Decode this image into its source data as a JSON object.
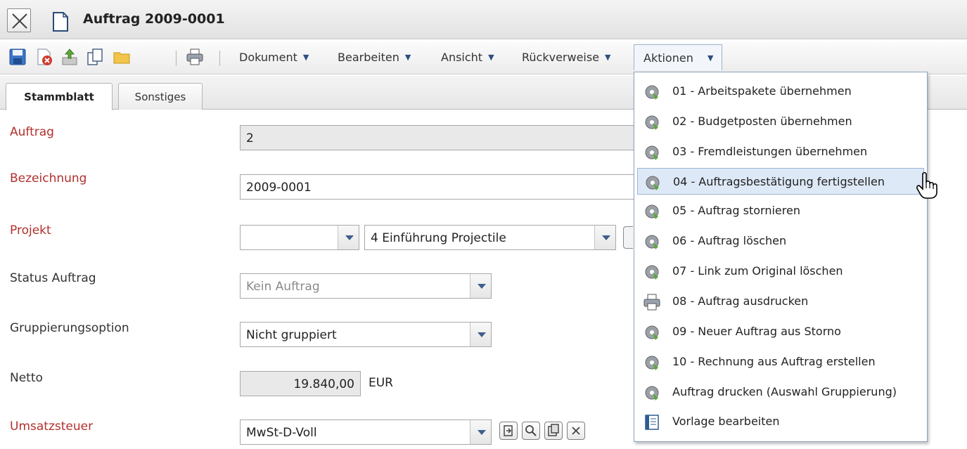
{
  "window": {
    "title": "Auftrag 2009-0001"
  },
  "toolbar": {
    "icons": [
      "save-icon",
      "delete-icon",
      "upload-icon",
      "copy-icon",
      "folder-icon",
      "print-icon"
    ],
    "menus": [
      {
        "label": "Dokument"
      },
      {
        "label": "Bearbeiten"
      },
      {
        "label": "Ansicht"
      },
      {
        "label": "Rückverweise"
      },
      {
        "label": "Aktionen"
      }
    ]
  },
  "tabs": [
    {
      "label": "Stammblatt",
      "active": true
    },
    {
      "label": "Sonstiges",
      "active": false
    }
  ],
  "form": {
    "auftrag": {
      "label": "Auftrag",
      "value": "2"
    },
    "bezeichnung": {
      "label": "Bezeichnung",
      "value": "2009-0001"
    },
    "projekt": {
      "label": "Projekt",
      "value1": "",
      "value2": "4 Einführung Projectile"
    },
    "status": {
      "label": "Status Auftrag",
      "value": "Kein Auftrag"
    },
    "gruppierung": {
      "label": "Gruppierungsoption",
      "value": "Nicht gruppiert"
    },
    "netto": {
      "label": "Netto",
      "value": "19.840,00",
      "unit": "EUR"
    },
    "umsatzsteuer": {
      "label": "Umsatzsteuer",
      "value": "MwSt-D-Voll"
    }
  },
  "actions_menu": {
    "items": [
      {
        "label": "01 - Arbeitspakete übernehmen",
        "icon": "gear-icon"
      },
      {
        "label": "02 - Budgetposten übernehmen",
        "icon": "gear-icon"
      },
      {
        "label": "03 - Fremdleistungen übernehmen",
        "icon": "gear-icon"
      },
      {
        "label": "04 - Auftragsbestätigung fertigstellen",
        "icon": "gear-icon",
        "hover": true
      },
      {
        "label": "05 - Auftrag stornieren",
        "icon": "gear-icon"
      },
      {
        "label": "06 - Auftrag löschen",
        "icon": "gear-icon"
      },
      {
        "label": "07 - Link zum Original löschen",
        "icon": "gear-icon"
      },
      {
        "label": "08 - Auftrag ausdrucken",
        "icon": "printer-icon"
      },
      {
        "label": "09 - Neuer Auftrag aus Storno",
        "icon": "gear-icon"
      },
      {
        "label": "10 - Rechnung aus Auftrag erstellen",
        "icon": "gear-icon"
      },
      {
        "label": "Auftrag drucken (Auswahl Gruppierung)",
        "icon": "gear-icon"
      },
      {
        "label": "Vorlage bearbeiten",
        "icon": "template-icon"
      }
    ]
  },
  "colors": {
    "required_label": "#b0302d",
    "menu_hover": "#dde9f7",
    "menu_border": "#8ea3bd"
  }
}
